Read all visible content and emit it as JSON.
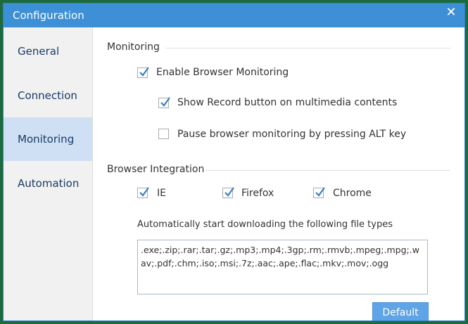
{
  "window": {
    "title": "Configuration",
    "close_glyph": "✕"
  },
  "sidebar": {
    "items": [
      {
        "label": "General",
        "active": false
      },
      {
        "label": "Connection",
        "active": false
      },
      {
        "label": "Monitoring",
        "active": true
      },
      {
        "label": "Automation",
        "active": false
      }
    ]
  },
  "monitoring": {
    "section_title": "Monitoring",
    "enable_browser_monitoring": {
      "label": "Enable Browser Monitoring",
      "checked": true
    },
    "show_record_button": {
      "label": "Show Record button on multimedia contents",
      "checked": true
    },
    "pause_alt": {
      "label": "Pause browser monitoring by pressing ALT key",
      "checked": false
    }
  },
  "integration": {
    "section_title": "Browser Integration",
    "browsers": [
      {
        "label": "IE",
        "checked": true
      },
      {
        "label": "Firefox",
        "checked": true
      },
      {
        "label": "Chrome",
        "checked": true
      }
    ],
    "filetypes_label": "Automatically start downloading the following file types",
    "filetypes_value": ".exe;.zip;.rar;.tar;.gz;.mp3;.mp4;.3gp;.rm;.rmvb;.mpeg;.mpg;.wav;.pdf;.chm;.iso;.msi;.7z;.aac;.ape;.flac;.mkv;.mov;.ogg",
    "default_button": "Default"
  },
  "colors": {
    "titlebar": "#3d8fd6",
    "accent": "#5ea4e6",
    "active_sidebar": "#cfe0f5",
    "check": "#3d7fc2"
  },
  "icons": {
    "checkbox_check": "check-icon",
    "close": "close-icon"
  }
}
